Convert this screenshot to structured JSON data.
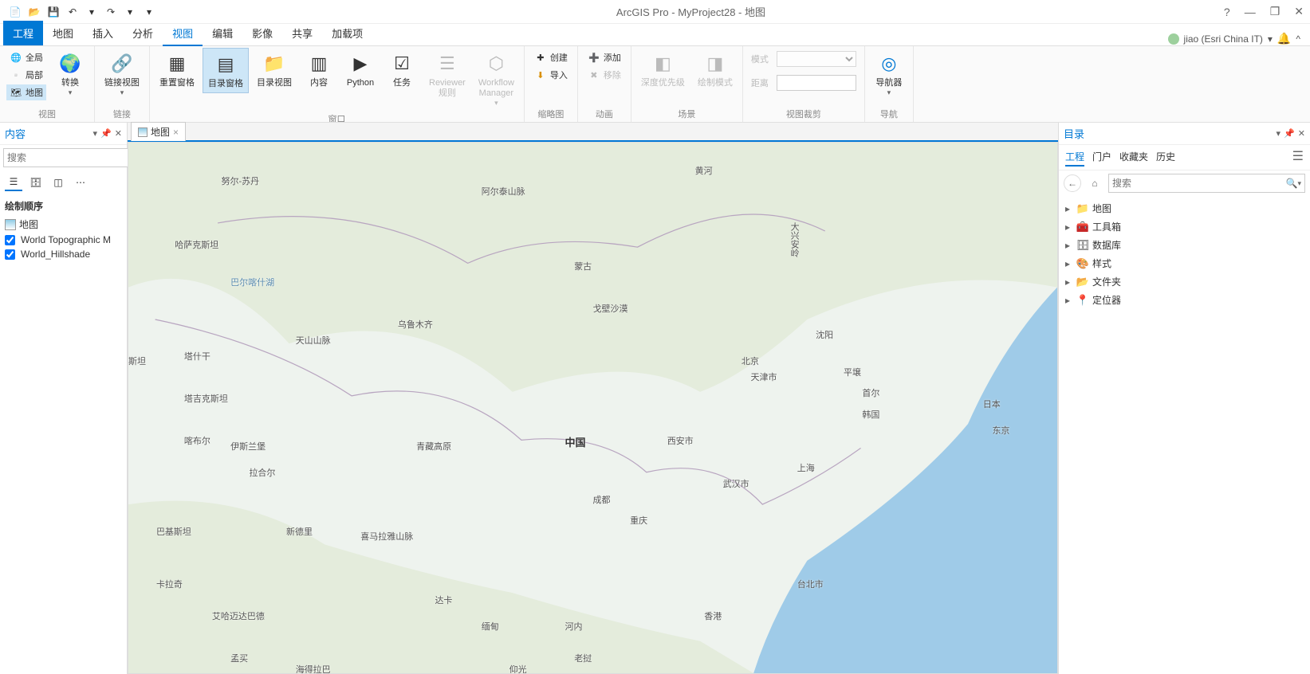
{
  "title": "ArcGIS Pro - MyProject28 - 地图",
  "user": {
    "name": "jiao (Esri China IT)"
  },
  "qat": {
    "tips": [
      "New",
      "Open",
      "Save",
      "Undo",
      "Redo"
    ]
  },
  "win": {
    "help": "?",
    "min": "—",
    "max": "❐",
    "close": "✕",
    "up": "^"
  },
  "tabs": {
    "project": "工程",
    "items": [
      "地图",
      "插入",
      "分析",
      "视图",
      "编辑",
      "影像",
      "共享",
      "加载项"
    ],
    "active_index": 3
  },
  "ribbon": {
    "groups": {
      "view": {
        "label": "视图",
        "global": "全局",
        "local": "局部",
        "map": "地图",
        "convert": "转换"
      },
      "link": {
        "label": "链接",
        "btn": "链接视图"
      },
      "windows": {
        "label": "窗口",
        "reset": "重置窗格",
        "catpane": "目录窗格",
        "catview": "目录视图",
        "content": "内容",
        "python": "Python",
        "tasks": "任务",
        "reviewer": "Reviewer\n规则",
        "wfm": "Workflow\nManager"
      },
      "thumb": {
        "label": "缩略图",
        "create": "创建",
        "import": "导入"
      },
      "anim": {
        "label": "动画",
        "add": "添加",
        "remove": "移除"
      },
      "scene": {
        "label": "场景",
        "depth": "深度优先级",
        "drawmode": "绘制模式"
      },
      "clip": {
        "label": "视图裁剪",
        "mode": "模式",
        "distance": "距离"
      },
      "nav": {
        "label": "导航",
        "btn": "导航器"
      }
    }
  },
  "left": {
    "title": "内容",
    "search_placeholder": "搜索",
    "section": "绘制顺序",
    "map": "地图",
    "layers": [
      "World Topographic M",
      "World_Hillshade"
    ]
  },
  "doc_tab": "地图",
  "map_labels": {
    "china": "中国",
    "mongolia": "蒙古",
    "gobi": "戈壁沙漠",
    "beijing": "北京",
    "tianjin": "天津市",
    "shanghai": "上海",
    "shenyang": "沈阳",
    "pyongyang": "平壌",
    "seoul": "首尔",
    "korea": "韩国",
    "japan": "日本",
    "tokyo": "东京",
    "wuhan": "武汉市",
    "xian": "西安市",
    "chengdu": "成都",
    "chongqing": "重庆",
    "hongkong": "香港",
    "taipei": "台北市",
    "urumqi": "乌鲁木齐",
    "kazkh": "哈萨克斯坦",
    "nursultan": "努尔-苏丹",
    "tianshan": "天山山脉",
    "tajik": "塔吉克斯坦",
    "tashkent": "塔什干",
    "stan": "斯坦",
    "kabul": "喀布尔",
    "islamabad": "伊斯兰堡",
    "lahore": "拉合尔",
    "delhi": "新德里",
    "himalaya": "喜马拉雅山脉",
    "tibet": "青藏高原",
    "karachi": "卡拉奇",
    "ahmedabad": "艾哈迈达巴德",
    "dhaka": "达卡",
    "hanoi": "河内",
    "myanmar": "缅甸",
    "laos": "老挝",
    "mengmai": "孟买",
    "bajistan": "巴基斯坦",
    "haidelaba": "海得拉巴",
    "altai": "阿尔泰山脉",
    "helan": "黄河",
    "balkash": "巴尔喀什湖",
    "daxingan": "大兴安岭",
    "yangon": "仰光"
  },
  "right": {
    "title": "目录",
    "tabs": [
      "工程",
      "门户",
      "收藏夹",
      "历史"
    ],
    "active_tab": 0,
    "search_placeholder": "搜索",
    "tree": [
      "地图",
      "工具箱",
      "数据库",
      "样式",
      "文件夹",
      "定位器"
    ]
  }
}
